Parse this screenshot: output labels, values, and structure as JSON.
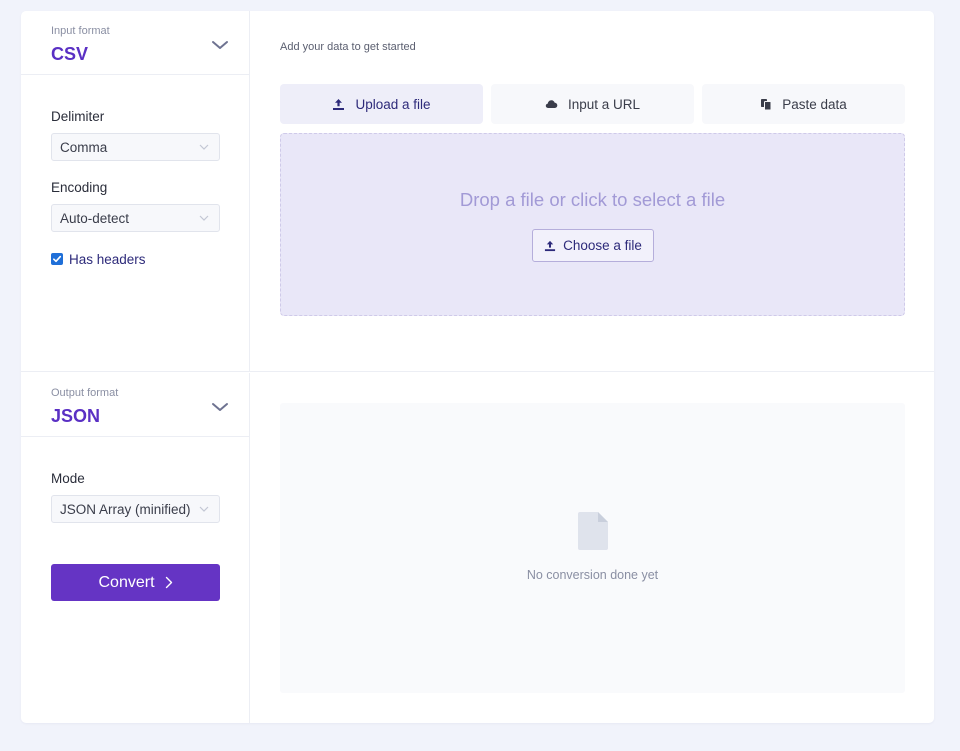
{
  "input_format": {
    "label": "Input format",
    "value": "CSV",
    "delimiter": {
      "label": "Delimiter",
      "value": "Comma"
    },
    "encoding": {
      "label": "Encoding",
      "value": "Auto-detect"
    },
    "has_headers": {
      "label": "Has headers",
      "checked": true
    }
  },
  "output_format": {
    "label": "Output format",
    "value": "JSON",
    "mode": {
      "label": "Mode",
      "value": "JSON Array (minified)"
    },
    "convert_label": "Convert"
  },
  "source": {
    "hint": "Add your data to get started",
    "tabs": [
      {
        "label": "Upload a file",
        "icon": "upload-icon",
        "active": true
      },
      {
        "label": "Input a URL",
        "icon": "cloud-icon",
        "active": false
      },
      {
        "label": "Paste data",
        "icon": "paste-icon",
        "active": false
      }
    ],
    "dropzone_text": "Drop a file or click to select a file",
    "choose_label": "Choose a file"
  },
  "result": {
    "empty_icon": "file-icon",
    "empty_text": "No conversion done yet"
  },
  "colors": {
    "accent": "#6534c4",
    "format_text": "#5a30c4",
    "dropzone_bg": "#e9e7f8",
    "page_bg": "#f1f3fb",
    "checkbox": "#1f6fd8"
  }
}
